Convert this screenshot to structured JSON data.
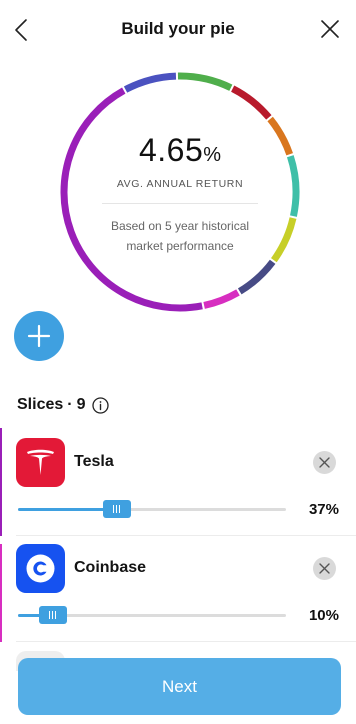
{
  "header": {
    "title": "Build your pie"
  },
  "summary": {
    "return_value": "4.65",
    "return_unit": "%",
    "return_label": "AVG. ANNUAL RETURN",
    "basis_line1": "Based on 5 year historical",
    "basis_line2": "market performance"
  },
  "donut_colors": [
    "#4b52c0",
    "#4fae4b",
    "#b81a2c",
    "#d9761e",
    "#3fbfa8",
    "#c7cf28",
    "#474b85",
    "#d72ec0",
    "#9a1fb8"
  ],
  "slices": {
    "label": "Slices",
    "separator": "·",
    "count": "9",
    "items": [
      {
        "name": "Tesla",
        "percent_label": "37%",
        "percent": 37,
        "logo_color": "#e31937",
        "accent_color": "#9a1fb8"
      },
      {
        "name": "Coinbase",
        "percent_label": "10%",
        "percent": 10,
        "logo_color": "#1652f0",
        "accent_color": "#d72ec0"
      }
    ]
  },
  "footer": {
    "next_label": "Next"
  },
  "colors": {
    "accent": "#3fa0e0",
    "next_button": "#55aee6"
  }
}
